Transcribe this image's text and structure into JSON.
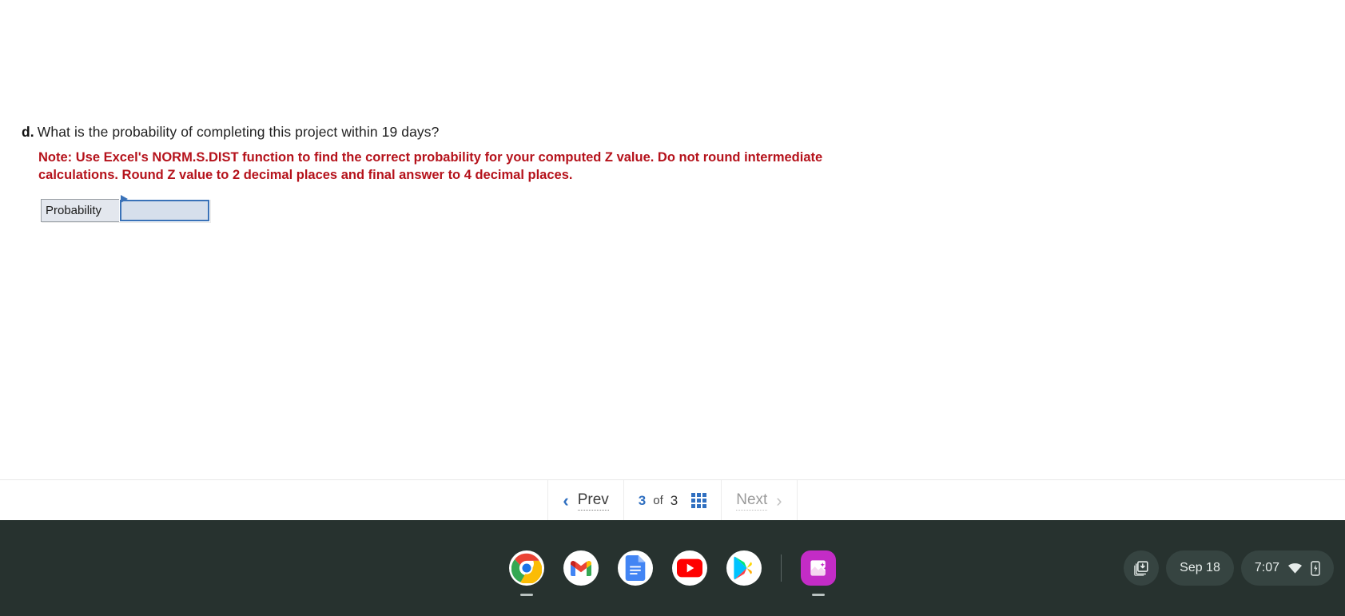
{
  "worksheet": {
    "question": {
      "letter": "d.",
      "text": "What is the probability of completing this project within 19 days?",
      "note": "Note: Use Excel's NORM.S.DIST function to find the correct probability for your computed Z value. Do not round intermediate calculations. Round Z value to 2 decimal places and final answer to 4 decimal places.",
      "note_color": "#b5121b"
    },
    "answer_table": {
      "row_label": "Probability",
      "input_value": "",
      "input_placeholder": ""
    }
  },
  "pagination": {
    "prev_label": "Prev",
    "next_label": "Next",
    "prev_chevron": "‹",
    "next_chevron": "›",
    "current_page": "3",
    "of_label": "of",
    "total_pages": "3",
    "grid_icon_name": "grid-view-icon",
    "accent_color": "#2f6fc0"
  },
  "shelf": {
    "apps": [
      {
        "name": "chrome",
        "label": "Chrome",
        "running": true
      },
      {
        "name": "gmail",
        "label": "Gmail",
        "running": false
      },
      {
        "name": "docs",
        "label": "Docs",
        "running": false
      },
      {
        "name": "youtube",
        "label": "YouTube",
        "running": false
      },
      {
        "name": "play-store",
        "label": "Play Store",
        "running": false
      },
      {
        "name": "photos",
        "label": "Photos",
        "running": true
      }
    ],
    "tray": {
      "downloads_icon": "downloads-tote-icon",
      "date": "Sep 18",
      "time": "7:07",
      "wifi_icon": "wifi-icon",
      "battery_icon": "battery-charging-icon"
    }
  }
}
